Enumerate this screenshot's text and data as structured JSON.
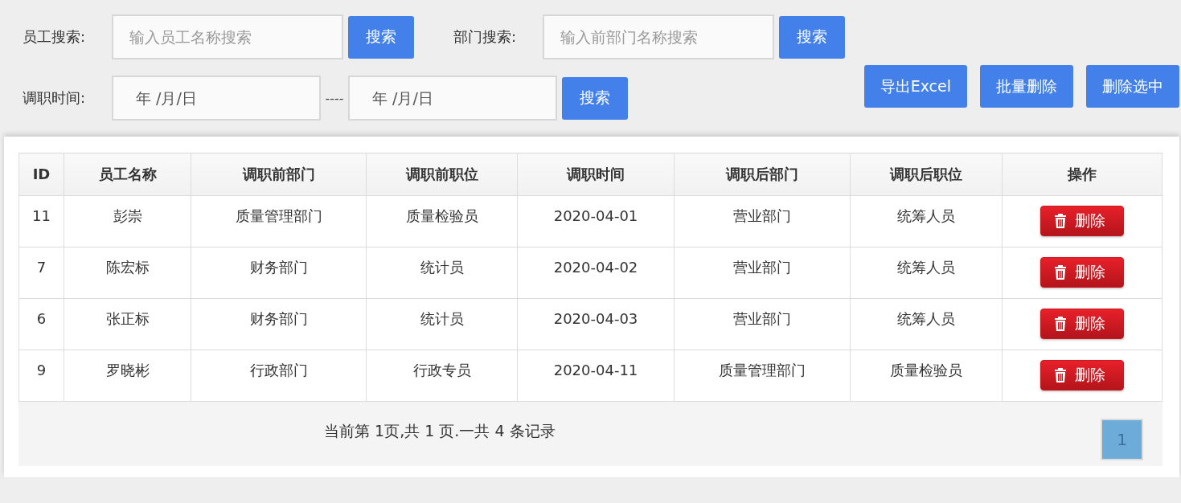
{
  "filters": {
    "employee": {
      "label": "员工搜索:",
      "placeholder": "输入员工名称搜索",
      "button": "搜索"
    },
    "department": {
      "label": "部门搜索:",
      "placeholder": "输入前部门名称搜索",
      "button": "搜索"
    },
    "date": {
      "label": "调职时间:",
      "from_placeholder": "年 /月/日",
      "separator": "----",
      "to_placeholder": "年 /月/日",
      "button": "搜索"
    }
  },
  "actions": [
    "导出Excel",
    "批量删除",
    "删除选中"
  ],
  "table": {
    "columns": [
      "ID",
      "员工名称",
      "调职前部门",
      "调职前职位",
      "调职时间",
      "调职后部门",
      "调职后职位",
      "操作"
    ],
    "rows": [
      {
        "cells": [
          "11",
          "彭崇",
          "质量管理部门",
          "质量检验员",
          "2020-04-01",
          "营业部门",
          "统筹人员"
        ],
        "action": "删除"
      },
      {
        "cells": [
          "7",
          "陈宏标",
          "财务部门",
          "统计员",
          "2020-04-02",
          "营业部门",
          "统筹人员"
        ],
        "action": "删除"
      },
      {
        "cells": [
          "6",
          "张正标",
          "财务部门",
          "统计员",
          "2020-04-03",
          "营业部门",
          "统筹人员"
        ],
        "action": "删除"
      },
      {
        "cells": [
          "9",
          "罗晓彬",
          "行政部门",
          "行政专员",
          "2020-04-11",
          "质量管理部门",
          "质量检验员"
        ],
        "action": "删除"
      }
    ]
  },
  "pagination": {
    "summary": "当前第 1页,共 1 页.一共 4 条记录",
    "pages": [
      {
        "label": "1",
        "selected": true
      }
    ]
  }
}
